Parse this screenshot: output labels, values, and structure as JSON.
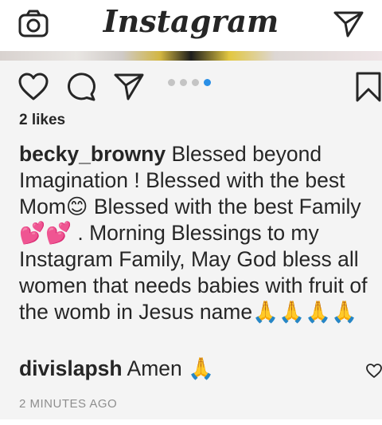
{
  "header": {
    "logo_text": "Instagram",
    "camera_icon": "camera-icon",
    "direct_icon": "paper-plane-icon"
  },
  "post": {
    "carousel": {
      "count": 4,
      "active_index": 3,
      "active_color": "#2a8fe6",
      "inactive_color": "#c4c4c4"
    },
    "likes_text": "2 likes",
    "caption": {
      "username": "becky_browny",
      "text": "Blessed beyond Imagination ! Blessed with the best Mom😊 Blessed with the best Family 💕💕 . Morning Blessings to my Instagram Family, May God bless all women that needs babies with fruit of the womb in Jesus name🙏🙏🙏🙏"
    },
    "comments": [
      {
        "username": "divislapsh",
        "text": "Amen 🙏"
      }
    ],
    "timestamp": "2 MINUTES AGO"
  }
}
